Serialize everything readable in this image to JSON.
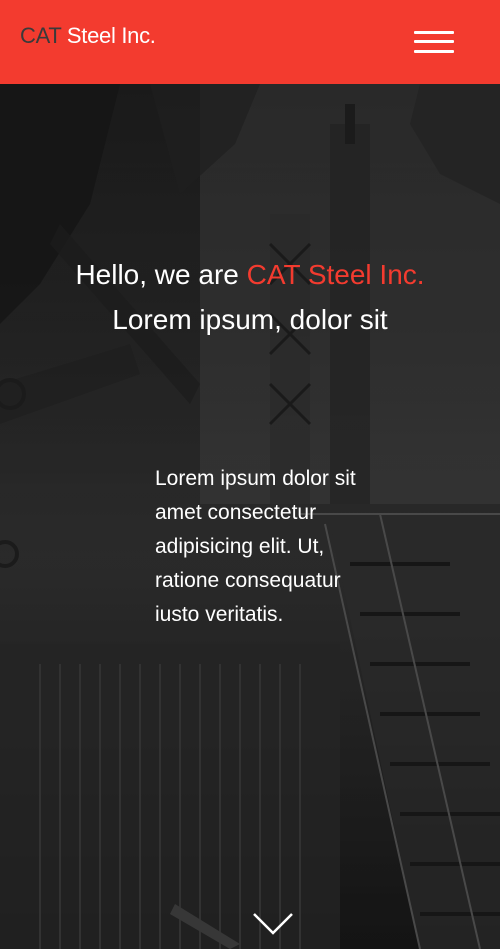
{
  "navbar": {
    "brand_prefix": "CAT",
    "brand_suffix": " Steel Inc.",
    "menu_icon": "hamburger-menu-icon",
    "background_color": "#f33b2f"
  },
  "hero": {
    "greeting": "Hello, we are ",
    "company": "CAT Steel Inc.",
    "tagline": "Lorem ipsum, dolor sit",
    "description": "Lorem ipsum dolor sit amet consectetur adipisicing elit. Ut, ratione consequatur iusto veritatis.",
    "scroll_icon": "chevron-down-icon",
    "accent_color": "#f33b2f"
  }
}
